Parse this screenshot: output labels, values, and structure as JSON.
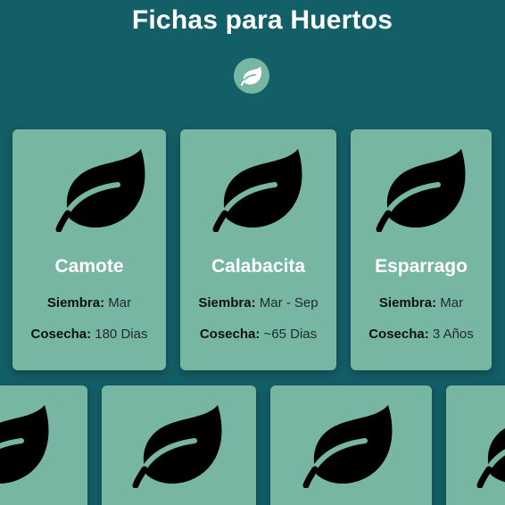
{
  "page": {
    "title": "Fichas para Huertos",
    "logo_icon": "leaf-icon",
    "colors": {
      "background": "#135f67",
      "card": "#77b6a2",
      "leaf": "#000000",
      "title": "#ffffff"
    }
  },
  "cards": [
    {
      "name": "Camote",
      "siembra_label": "Siembra:",
      "siembra": "Mar",
      "cosecha_label": "Cosecha:",
      "cosecha": "180 Dias",
      "icon": "leaf-icon"
    },
    {
      "name": "Calabacita",
      "siembra_label": "Siembra:",
      "siembra": "Mar - Sep",
      "cosecha_label": "Cosecha:",
      "cosecha": "~65 Dias",
      "icon": "leaf-icon"
    },
    {
      "name": "Esparrago",
      "siembra_label": "Siembra:",
      "siembra": "Mar",
      "cosecha_label": "Cosecha:",
      "cosecha": "3 Años",
      "icon": "leaf-icon"
    }
  ],
  "bottom_cards": [
    {
      "icon": "leaf-icon"
    },
    {
      "icon": "leaf-icon"
    },
    {
      "icon": "leaf-icon"
    },
    {
      "icon": "leaf-icon"
    }
  ]
}
